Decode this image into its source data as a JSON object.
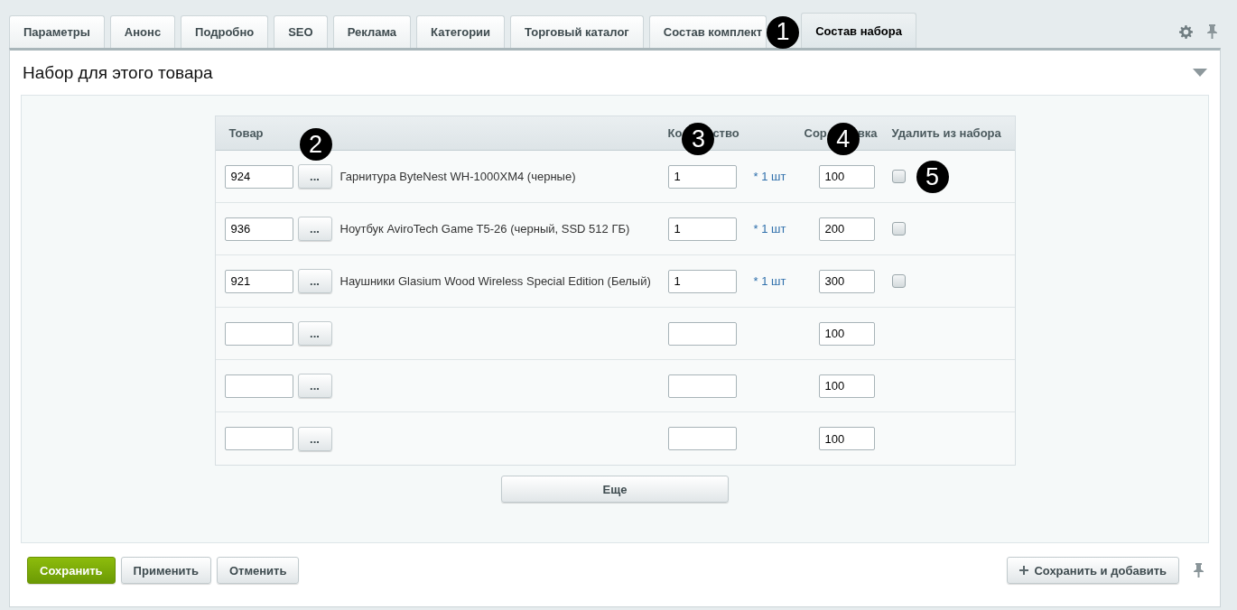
{
  "tabs": [
    {
      "label": "Параметры",
      "selected": false
    },
    {
      "label": "Анонс",
      "selected": false
    },
    {
      "label": "Подробно",
      "selected": false
    },
    {
      "label": "SEO",
      "selected": false
    },
    {
      "label": "Реклама",
      "selected": false
    },
    {
      "label": "Категории",
      "selected": false
    },
    {
      "label": "Торговый каталог",
      "selected": false
    },
    {
      "label": "Состав комплект",
      "selected": false,
      "marker": "1"
    },
    {
      "label": "Состав набора",
      "selected": true
    }
  ],
  "section": {
    "title": "Набор для этого товара",
    "expanded": true
  },
  "table": {
    "columns": [
      {
        "label_parts": [
          "Товар"
        ],
        "marker": "2"
      },
      {
        "label_parts": [
          "Ко",
          "ство"
        ],
        "marker": "3"
      },
      {
        "label_parts": [
          "Сор",
          "вка"
        ],
        "marker": "4"
      },
      {
        "label_parts": [
          "Удалить из набора"
        ]
      }
    ],
    "rows": [
      {
        "product_id": "924",
        "name": "Гарнитура ByteNest WH-1000XM4 (черные)",
        "quantity": "1",
        "unit": "* 1 шт",
        "sort": "100",
        "delete": false,
        "marker": "5"
      },
      {
        "product_id": "936",
        "name": "Ноутбук AviroTech Game T5-26 (черный, SSD 512 ГБ)",
        "quantity": "1",
        "unit": "* 1 шт",
        "sort": "200",
        "delete": false
      },
      {
        "product_id": "921",
        "name": "Наушники Glasium Wood Wireless Special Edition (Белый)",
        "quantity": "1",
        "unit": "* 1 шт",
        "sort": "300",
        "delete": false
      },
      {
        "sort": "100"
      },
      {
        "sort": "100"
      },
      {
        "sort": "100"
      }
    ]
  },
  "browse_label": "...",
  "more_button": "Еще",
  "footer": {
    "buttons": [
      {
        "label": "Сохранить",
        "kind": "primary"
      },
      {
        "label": "Применить",
        "kind": "normal"
      },
      {
        "label": "Отменить",
        "kind": "normal"
      }
    ],
    "save_add": "Сохранить и добавить"
  }
}
